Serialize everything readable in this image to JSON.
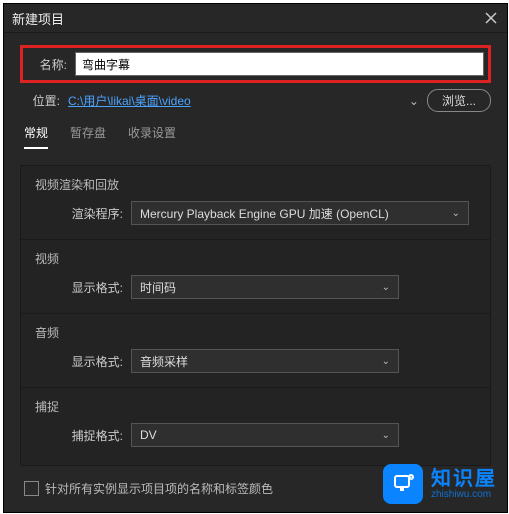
{
  "title": "新建项目",
  "name": {
    "label": "名称:",
    "value": "弯曲字幕"
  },
  "location": {
    "label": "位置:",
    "value": "C:\\用户\\likai\\桌面\\video",
    "browse": "浏览..."
  },
  "tabs": {
    "general": "常规",
    "scratch": "暂存盘",
    "ingest": "收录设置"
  },
  "sections": {
    "render": {
      "title": "视频渲染和回放",
      "label": "渲染程序:",
      "value": "Mercury Playback Engine GPU 加速 (OpenCL)"
    },
    "video": {
      "title": "视频",
      "label": "显示格式:",
      "value": "时间码"
    },
    "audio": {
      "title": "音频",
      "label": "显示格式:",
      "value": "音频采样"
    },
    "capture": {
      "title": "捕捉",
      "label": "捕捉格式:",
      "value": "DV"
    }
  },
  "checkbox": "针对所有实例显示项目项的名称和标签颜色",
  "watermark": {
    "brand": "知识屋",
    "url": "zhishiwu.com"
  }
}
